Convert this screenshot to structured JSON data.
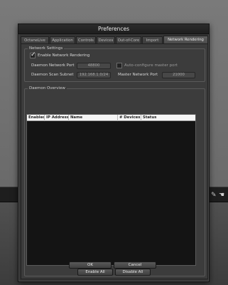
{
  "dialog": {
    "title": "Preferences"
  },
  "tabs": [
    {
      "label": "OctaneLive"
    },
    {
      "label": "Application"
    },
    {
      "label": "Controls"
    },
    {
      "label": "Devices"
    },
    {
      "label": "Out-of-Core"
    },
    {
      "label": "Import"
    },
    {
      "label": "Network Rendering",
      "active": true
    }
  ],
  "network_settings": {
    "title": "Network Settings",
    "enable_label": "Enable Network Rendering",
    "enable_checked": true,
    "daemon_port_label": "Daemon Network Port",
    "daemon_port_value": "48800",
    "auto_configure_label": "Auto-configure master port",
    "auto_configure_checked": false,
    "scan_subnet_label": "Daemon Scan Subnet",
    "scan_subnet_value": "192.168.1.0/24",
    "master_port_label": "Master Network Port",
    "master_port_value": "21000"
  },
  "daemon_overview": {
    "title": "Daemon Overview",
    "columns": [
      "Enabled",
      "IP Address",
      "Name",
      "# Devices",
      "Status"
    ],
    "enable_all_label": "Enable All",
    "disable_all_label": "Disable All"
  },
  "footer": {
    "ok_label": "OK",
    "cancel_label": "Cancel"
  },
  "icons": {
    "toolbar_1": "wrench-icon",
    "toolbar_2": "hand-icon"
  }
}
